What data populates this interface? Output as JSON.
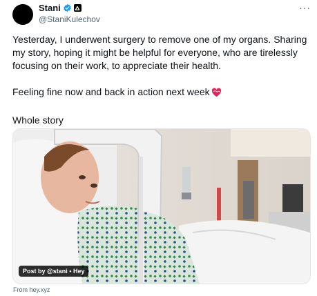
{
  "author": {
    "name": "Stani",
    "handle": "@StaniKulechov"
  },
  "menu": {
    "more_label": "···"
  },
  "tweet": {
    "paragraph1": "Yesterday, I underwent surgery to remove one of my organs. Sharing my story, hoping it might be helpful for everyone, who are tirelessly focusing on their work, to appreciate their health.",
    "paragraph2": "Feeling fine now and back in action next week",
    "paragraph3": "Whole story"
  },
  "media": {
    "credit": "Post by @stani • Hey"
  },
  "source": {
    "label": "From hey.xyz"
  },
  "colors": {
    "text": "#0f1419",
    "secondary": "#536471",
    "verified": "#1d9bf0",
    "heart": "#e0245e"
  },
  "icons": [
    "verified-badge-icon",
    "affiliate-badge-icon",
    "more-icon",
    "heart-icon"
  ]
}
